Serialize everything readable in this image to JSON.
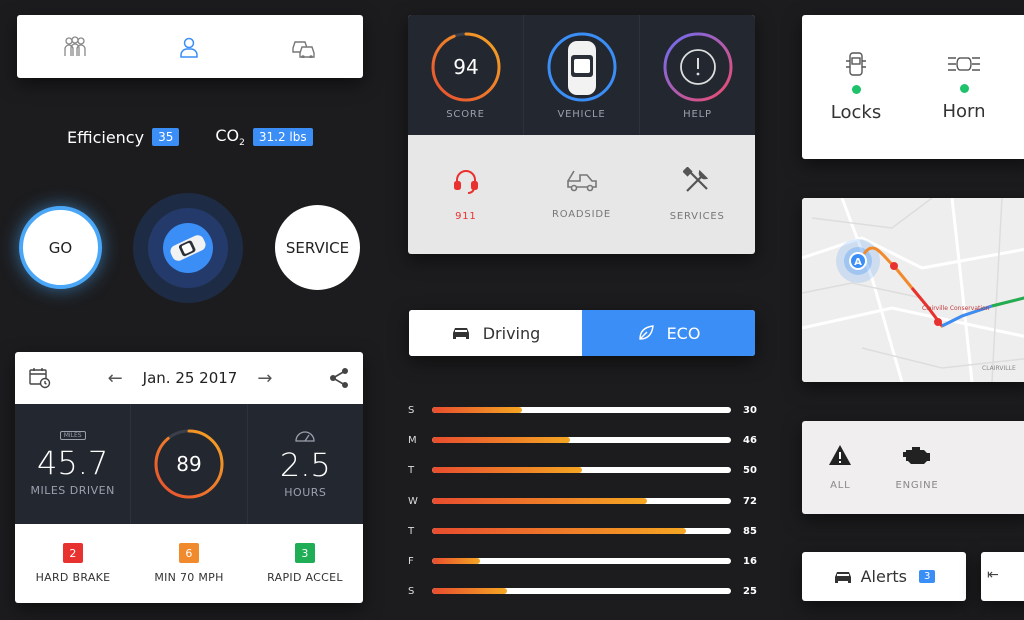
{
  "tabs": {
    "people_icon": "group-icon",
    "person_icon": "person-icon",
    "cars_icon": "cars-icon"
  },
  "efficiency": {
    "label": "Efficiency",
    "value": "35",
    "co2_label_main": "CO",
    "co2_label_sub": "2",
    "co2_value": "31.2 lbs"
  },
  "buttons": {
    "go": "GO",
    "service": "SERVICE"
  },
  "trip": {
    "date": "Jan. 25 2017",
    "miles_badge": "MILES",
    "miles_value": "45.7",
    "miles_label": "MILES DRIVEN",
    "score_value": "89",
    "score_fraction": 0.89,
    "hours_value": "2.5",
    "hours_label": "HOURS",
    "events": [
      {
        "count": "2",
        "label": "HARD BRAKE",
        "color": "#e8322f"
      },
      {
        "count": "6",
        "label": "MIN 70 MPH",
        "color": "#f08a2d"
      },
      {
        "count": "3",
        "label": "RAPID ACCEL",
        "color": "#1fae55"
      }
    ]
  },
  "score_card": {
    "score_value": "94",
    "score_fraction": 0.94,
    "score_label": "SCORE",
    "vehicle_label": "VEHICLE",
    "help_label": "HELP",
    "services": [
      {
        "label": "911",
        "icon": "headset-icon",
        "color": "#e8322f"
      },
      {
        "label": "ROADSIDE",
        "icon": "tow-truck-icon",
        "color": "#888888"
      },
      {
        "label": "SERVICES",
        "icon": "tools-icon",
        "color": "#888888"
      }
    ]
  },
  "mode": {
    "driving": "Driving",
    "eco": "ECO"
  },
  "weekly": [
    {
      "day": "S",
      "value": 30
    },
    {
      "day": "M",
      "value": 46
    },
    {
      "day": "T",
      "value": 50
    },
    {
      "day": "W",
      "value": 72
    },
    {
      "day": "T",
      "value": 85
    },
    {
      "day": "F",
      "value": 16
    },
    {
      "day": "S",
      "value": 25
    }
  ],
  "weekly_max": 100,
  "controls": {
    "locks": "Locks",
    "horn": "Horn"
  },
  "map": {
    "marker": "A",
    "place1": "Clairville Conservation",
    "place2": "CLAIRVILLE"
  },
  "alerts": {
    "all": "ALL",
    "engine": "ENGINE",
    "button_label": "Alerts",
    "button_count": "3"
  }
}
